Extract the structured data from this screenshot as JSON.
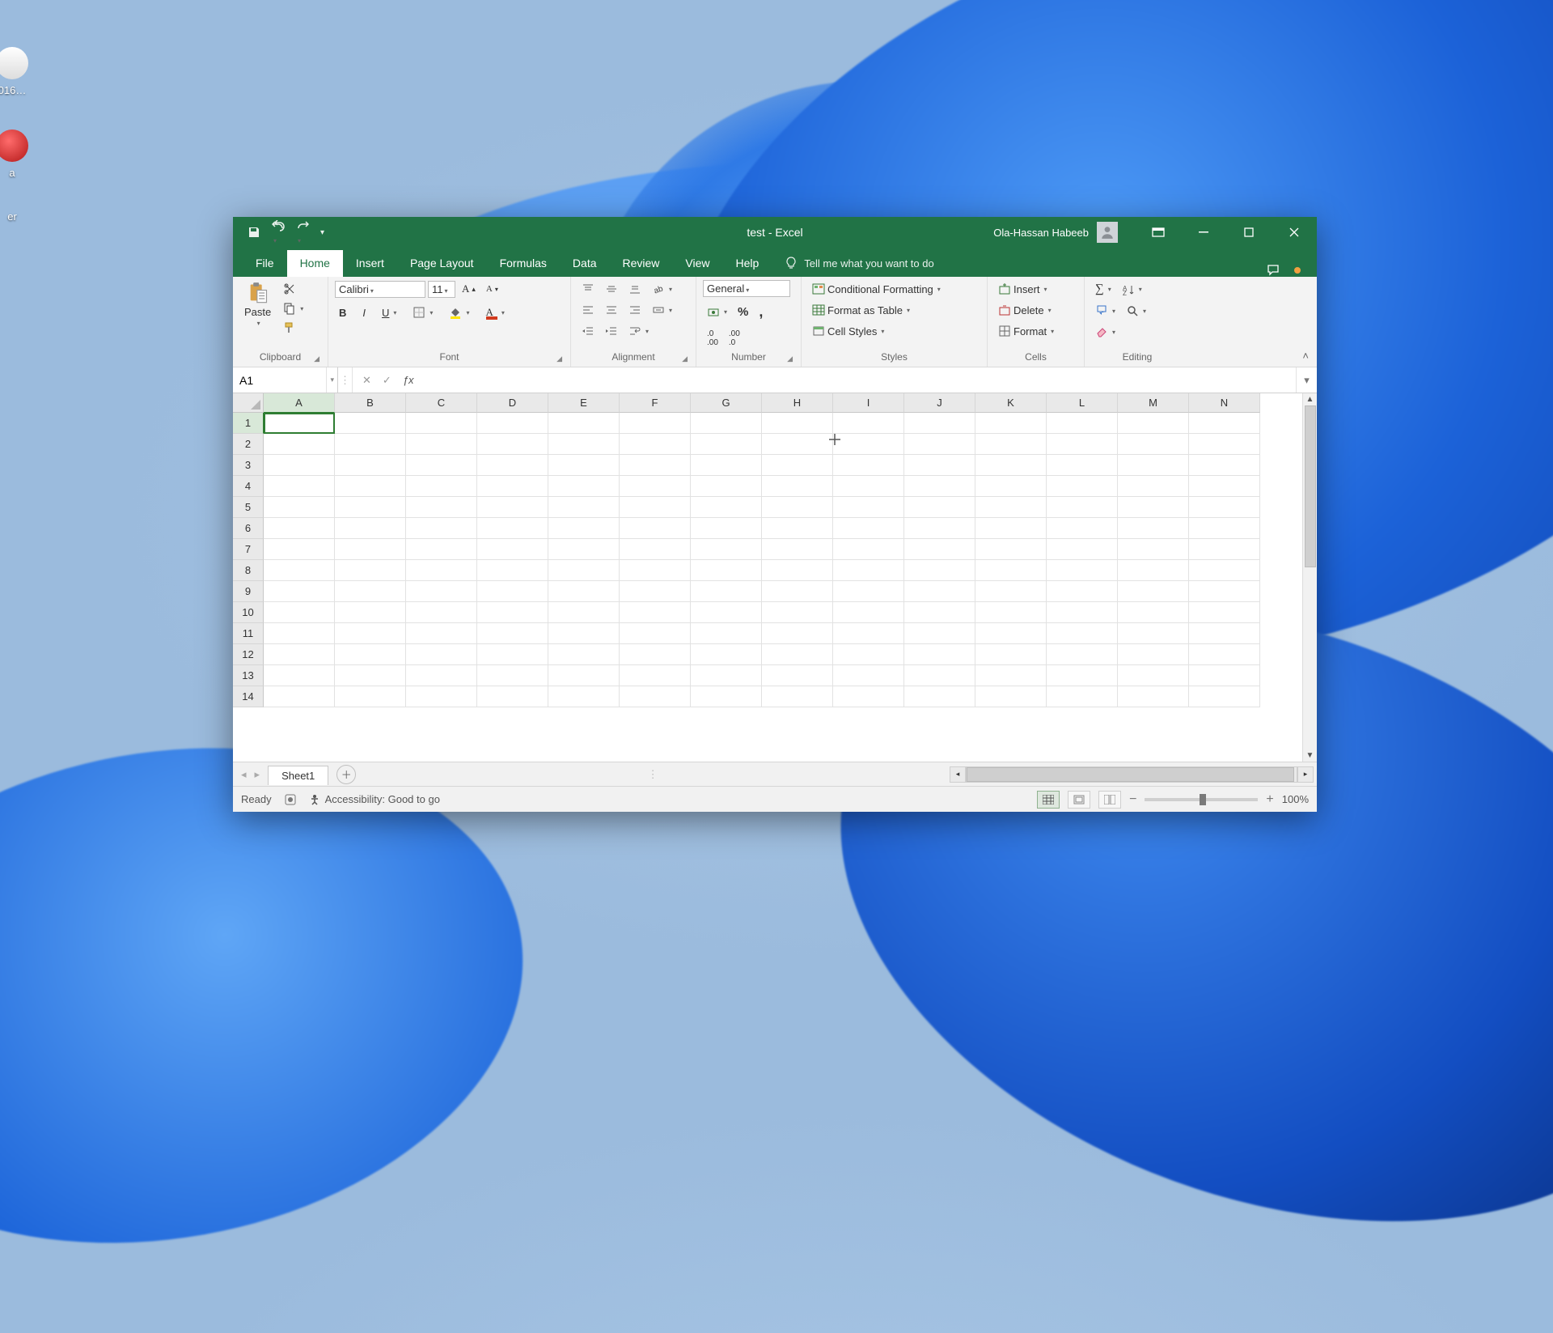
{
  "desktop": {
    "icon1_label": "016…",
    "icon2_label": "a",
    "icon3_label": "er"
  },
  "titlebar": {
    "title": "test  -  Excel",
    "user": "Ola-Hassan Habeeb"
  },
  "tabs": {
    "file": "File",
    "home": "Home",
    "insert": "Insert",
    "page_layout": "Page Layout",
    "formulas": "Formulas",
    "data": "Data",
    "review": "Review",
    "view": "View",
    "help": "Help",
    "tellme": "Tell me what you want to do"
  },
  "ribbon": {
    "clipboard": {
      "paste": "Paste",
      "label": "Clipboard"
    },
    "font": {
      "name": "Calibri",
      "size": "11",
      "label": "Font"
    },
    "alignment": {
      "label": "Alignment"
    },
    "number": {
      "format": "General",
      "label": "Number"
    },
    "styles": {
      "cond": "Conditional Formatting",
      "table": "Format as Table",
      "cell": "Cell Styles",
      "label": "Styles"
    },
    "cells": {
      "insert": "Insert",
      "delete": "Delete",
      "format": "Format",
      "label": "Cells"
    },
    "editing": {
      "label": "Editing"
    }
  },
  "namebox": "A1",
  "columns": [
    "A",
    "B",
    "C",
    "D",
    "E",
    "F",
    "G",
    "H",
    "I",
    "J",
    "K",
    "L",
    "M",
    "N"
  ],
  "rows": [
    "1",
    "2",
    "3",
    "4",
    "5",
    "6",
    "7",
    "8",
    "9",
    "10",
    "11",
    "12",
    "13",
    "14"
  ],
  "selected": {
    "col": "A",
    "row": "1"
  },
  "sheet": {
    "name": "Sheet1"
  },
  "status": {
    "ready": "Ready",
    "accessibility": "Accessibility: Good to go",
    "zoom": "100%"
  }
}
